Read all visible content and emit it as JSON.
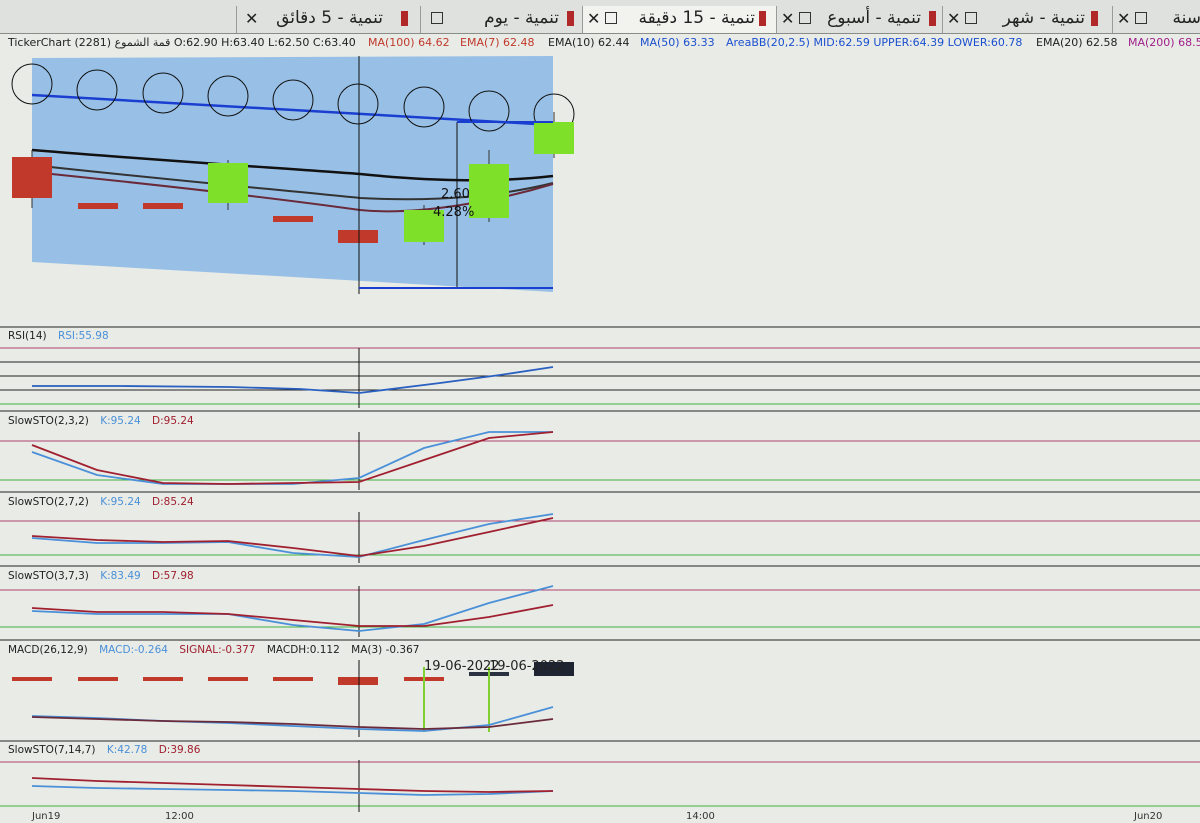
{
  "tabs": [
    {
      "label": "تنمية - 5 دقائق",
      "active": false
    },
    {
      "label": "تنمية - يوم",
      "active": false
    },
    {
      "label": "تنمية - 15 دقيقة",
      "active": true
    },
    {
      "label": "تنمية - أسبوع",
      "active": false
    },
    {
      "label": "تنمية - شهر",
      "active": false
    },
    {
      "label": "سنة",
      "active": false
    }
  ],
  "info": {
    "ticker": "TickerChart قمة الشموع (2281) O:62.90 H:63.40 L:62.50 C:63.40",
    "ma100": "MA(100) 64.62",
    "ema7": "EMA(7) 62.48",
    "ema10": "EMA(10) 62.44",
    "ma50": "MA(50) 63.33",
    "areabb": "AreaBB(20,2.5) MID:62.59 UPPER:64.39 LOWER:60.78",
    "ema20": "EMA(20) 62.58",
    "ma200": "MA(200) 68.5"
  },
  "measure": {
    "change": "2.60",
    "pct": "4.28%"
  },
  "panels": {
    "rsi": {
      "name": "RSI(14)",
      "v1": "RSI:55.98"
    },
    "sto1": {
      "name": "SlowSTO(2,3,2)",
      "k": "K:95.24",
      "d": "D:95.24"
    },
    "sto2": {
      "name": "SlowSTO(2,7,2)",
      "k": "K:95.24",
      "d": "D:85.24"
    },
    "sto3": {
      "name": "SlowSTO(3,7,3)",
      "k": "K:83.49",
      "d": "D:57.98"
    },
    "macd": {
      "name": "MACD(26,12,9)",
      "macd": "MACD:-0.264",
      "signal": "SIGNAL:-0.377",
      "macdh": "MACDH:0.112",
      "ma": "MA(3) -0.367"
    },
    "sto4": {
      "name": "SlowSTO(7,14,7)",
      "k": "K:42.78",
      "d": "D:39.86"
    }
  },
  "macd_tags": [
    "19-06-2022",
    "19-06-2022"
  ],
  "x_axis": [
    "Jun19",
    "12:00",
    "14:00",
    "Jun20"
  ],
  "colors": {
    "candle_up": "#7fe02a",
    "candle_down": "#c0392b",
    "bb_fill": "#8ab8e6",
    "k_line": "#4a90d9",
    "d_line": "#a02030",
    "upper_ref": "#b04070",
    "lower_ref": "#40b040"
  }
}
